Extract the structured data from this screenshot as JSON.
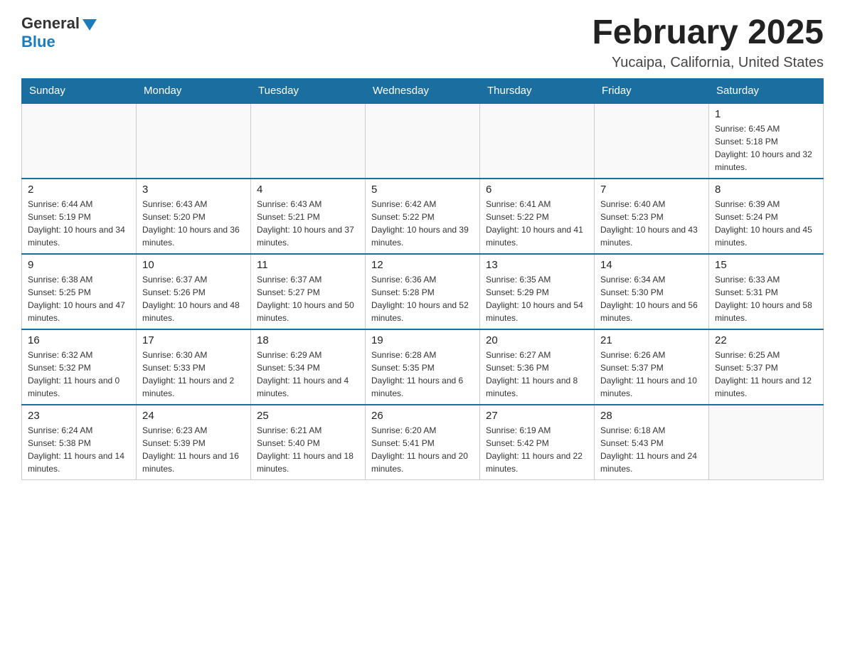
{
  "header": {
    "logo_general": "General",
    "logo_blue": "Blue",
    "month_title": "February 2025",
    "location": "Yucaipa, California, United States"
  },
  "days_of_week": [
    "Sunday",
    "Monday",
    "Tuesday",
    "Wednesday",
    "Thursday",
    "Friday",
    "Saturday"
  ],
  "weeks": [
    [
      {
        "day": "",
        "info": ""
      },
      {
        "day": "",
        "info": ""
      },
      {
        "day": "",
        "info": ""
      },
      {
        "day": "",
        "info": ""
      },
      {
        "day": "",
        "info": ""
      },
      {
        "day": "",
        "info": ""
      },
      {
        "day": "1",
        "info": "Sunrise: 6:45 AM\nSunset: 5:18 PM\nDaylight: 10 hours and 32 minutes."
      }
    ],
    [
      {
        "day": "2",
        "info": "Sunrise: 6:44 AM\nSunset: 5:19 PM\nDaylight: 10 hours and 34 minutes."
      },
      {
        "day": "3",
        "info": "Sunrise: 6:43 AM\nSunset: 5:20 PM\nDaylight: 10 hours and 36 minutes."
      },
      {
        "day": "4",
        "info": "Sunrise: 6:43 AM\nSunset: 5:21 PM\nDaylight: 10 hours and 37 minutes."
      },
      {
        "day": "5",
        "info": "Sunrise: 6:42 AM\nSunset: 5:22 PM\nDaylight: 10 hours and 39 minutes."
      },
      {
        "day": "6",
        "info": "Sunrise: 6:41 AM\nSunset: 5:22 PM\nDaylight: 10 hours and 41 minutes."
      },
      {
        "day": "7",
        "info": "Sunrise: 6:40 AM\nSunset: 5:23 PM\nDaylight: 10 hours and 43 minutes."
      },
      {
        "day": "8",
        "info": "Sunrise: 6:39 AM\nSunset: 5:24 PM\nDaylight: 10 hours and 45 minutes."
      }
    ],
    [
      {
        "day": "9",
        "info": "Sunrise: 6:38 AM\nSunset: 5:25 PM\nDaylight: 10 hours and 47 minutes."
      },
      {
        "day": "10",
        "info": "Sunrise: 6:37 AM\nSunset: 5:26 PM\nDaylight: 10 hours and 48 minutes."
      },
      {
        "day": "11",
        "info": "Sunrise: 6:37 AM\nSunset: 5:27 PM\nDaylight: 10 hours and 50 minutes."
      },
      {
        "day": "12",
        "info": "Sunrise: 6:36 AM\nSunset: 5:28 PM\nDaylight: 10 hours and 52 minutes."
      },
      {
        "day": "13",
        "info": "Sunrise: 6:35 AM\nSunset: 5:29 PM\nDaylight: 10 hours and 54 minutes."
      },
      {
        "day": "14",
        "info": "Sunrise: 6:34 AM\nSunset: 5:30 PM\nDaylight: 10 hours and 56 minutes."
      },
      {
        "day": "15",
        "info": "Sunrise: 6:33 AM\nSunset: 5:31 PM\nDaylight: 10 hours and 58 minutes."
      }
    ],
    [
      {
        "day": "16",
        "info": "Sunrise: 6:32 AM\nSunset: 5:32 PM\nDaylight: 11 hours and 0 minutes."
      },
      {
        "day": "17",
        "info": "Sunrise: 6:30 AM\nSunset: 5:33 PM\nDaylight: 11 hours and 2 minutes."
      },
      {
        "day": "18",
        "info": "Sunrise: 6:29 AM\nSunset: 5:34 PM\nDaylight: 11 hours and 4 minutes."
      },
      {
        "day": "19",
        "info": "Sunrise: 6:28 AM\nSunset: 5:35 PM\nDaylight: 11 hours and 6 minutes."
      },
      {
        "day": "20",
        "info": "Sunrise: 6:27 AM\nSunset: 5:36 PM\nDaylight: 11 hours and 8 minutes."
      },
      {
        "day": "21",
        "info": "Sunrise: 6:26 AM\nSunset: 5:37 PM\nDaylight: 11 hours and 10 minutes."
      },
      {
        "day": "22",
        "info": "Sunrise: 6:25 AM\nSunset: 5:37 PM\nDaylight: 11 hours and 12 minutes."
      }
    ],
    [
      {
        "day": "23",
        "info": "Sunrise: 6:24 AM\nSunset: 5:38 PM\nDaylight: 11 hours and 14 minutes."
      },
      {
        "day": "24",
        "info": "Sunrise: 6:23 AM\nSunset: 5:39 PM\nDaylight: 11 hours and 16 minutes."
      },
      {
        "day": "25",
        "info": "Sunrise: 6:21 AM\nSunset: 5:40 PM\nDaylight: 11 hours and 18 minutes."
      },
      {
        "day": "26",
        "info": "Sunrise: 6:20 AM\nSunset: 5:41 PM\nDaylight: 11 hours and 20 minutes."
      },
      {
        "day": "27",
        "info": "Sunrise: 6:19 AM\nSunset: 5:42 PM\nDaylight: 11 hours and 22 minutes."
      },
      {
        "day": "28",
        "info": "Sunrise: 6:18 AM\nSunset: 5:43 PM\nDaylight: 11 hours and 24 minutes."
      },
      {
        "day": "",
        "info": ""
      }
    ]
  ]
}
